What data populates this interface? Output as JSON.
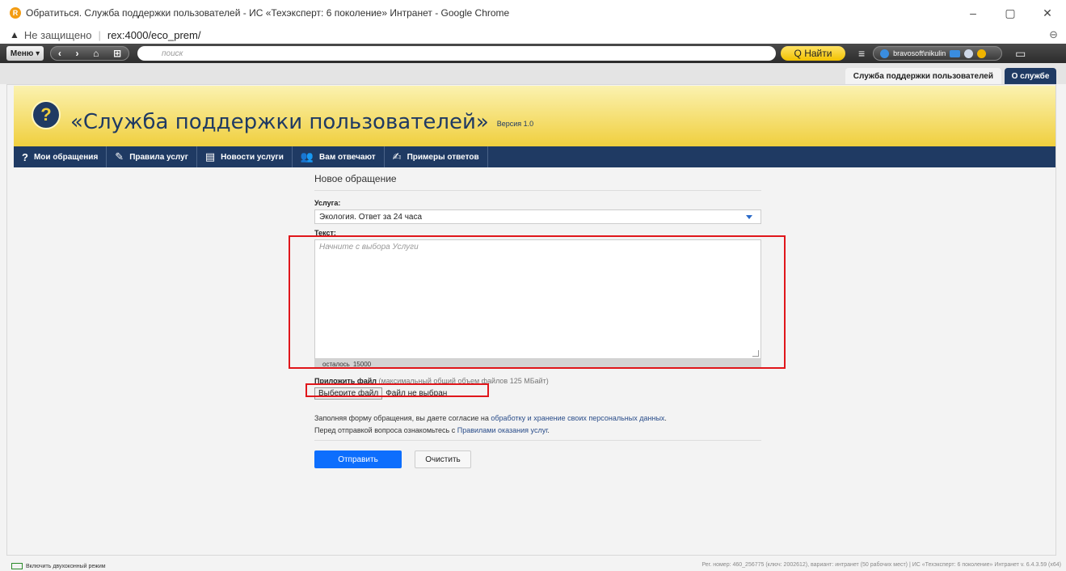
{
  "window": {
    "title": "Обратиться. Служба поддержки пользователей - ИС «Техэксперт: 6 поколение» Интранет - Google Chrome",
    "favicon_letter": "R",
    "minimize": "–",
    "restore": "▢",
    "close": "✕"
  },
  "address": {
    "security_icon": "▲",
    "security_text": "Не защищено",
    "separator": "|",
    "url": "rex:4000/eco_prem/",
    "zoom_icon": "⊖"
  },
  "toolbar": {
    "menu_label": "Меню ▾",
    "back": "‹",
    "forward": "›",
    "home": "⌂",
    "grid": "⊞",
    "search_placeholder": "поиск",
    "find_label": "Q Найти",
    "hamburger": "≡",
    "user": "bravosoft\\nikulin",
    "chat": "▭",
    "colors": {
      "find": "#f2c200",
      "dot_blue": "#3a8de0",
      "dot_yellow": "#f0b400",
      "dot_green": "#5cb85c"
    }
  },
  "tabs": {
    "support": "Служба поддержки пользователей",
    "about": "О службе"
  },
  "banner": {
    "icon": "?",
    "title": "«Служба поддержки пользователей»",
    "version": "Версия 1.0"
  },
  "nav": [
    {
      "icon": "?",
      "label": "Мои обращения"
    },
    {
      "icon": "✎",
      "label": "Правила услуг"
    },
    {
      "icon": "▤",
      "label": "Новости услуги"
    },
    {
      "icon": "👥",
      "label": "Вам отвечают"
    },
    {
      "icon": "✍",
      "label": "Примеры ответов"
    }
  ],
  "form": {
    "title": "Новое обращение",
    "service_label": "Услуга:",
    "service_value": "Экология. Ответ за 24 часа",
    "text_label": "Текст:",
    "text_placeholder": "Начните с выбора Услуги",
    "remaining_label": "осталось",
    "remaining_value": "15000",
    "attach_label": "Приложить файл",
    "attach_hint": "(максимальный общий объем файлов 125 МБайт)",
    "file_button": "Выберите файл",
    "file_status": "Файл не выбран",
    "consent_prefix": "Заполняя форму обращения, вы даете согласие на",
    "consent_link": "обработку и хранение своих персональных данных",
    "consent_suffix": ".",
    "rules_prefix": "Перед отправкой вопроса ознакомьтесь с",
    "rules_link": "Правилами оказания услуг",
    "rules_suffix": ".",
    "send": "Отправить",
    "clear": "Очистить"
  },
  "status": {
    "dual_mode": "Включить двухоконный режим",
    "info": "Рег. номер: 460_256775 (ключ: 2002612), вариант: интранет (50 рабочих мест)   |   ИС «Техэксперт: 6 поколение» Интранет v. 6.4.3.59 (x64)"
  }
}
